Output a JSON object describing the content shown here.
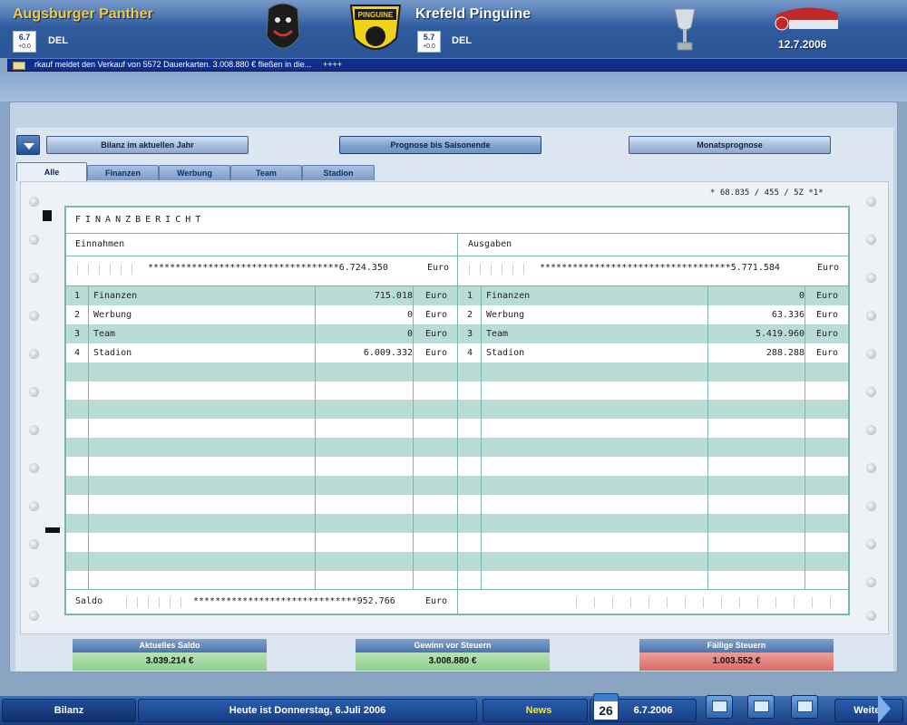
{
  "header": {
    "home_team": "Augsburger Panther",
    "home_rating": "6.7",
    "home_rating_delta": "+0.0",
    "home_league": "DEL",
    "away_team": "Krefeld Pinguine",
    "away_rating": "5.7",
    "away_rating_delta": "+0.0",
    "away_league": "DEL",
    "date": "12.7.2006"
  },
  "ticker": {
    "text": "rkauf meldet den Verkauf von 5572 Dauerkarten. 3.008.880 € fließen in die...",
    "suffix": "++++"
  },
  "toolbar": {
    "btn_current_year": "Bilanz im aktuellen Jahr",
    "btn_forecast_season": "Prognose bis Saisonende",
    "btn_monthly_forecast": "Monatsprognose"
  },
  "tabs": [
    "Alle",
    "Finanzen",
    "Werbung",
    "Team",
    "Stadion"
  ],
  "report": {
    "serial": "* 68.835 / 455 / 5Z  *1*",
    "title": "FINANZBERICHT",
    "income": {
      "label": "Einnahmen",
      "total": "***********************************6.724.350",
      "currency": "Euro",
      "rows": [
        {
          "n": "1",
          "name": "Finanzen",
          "value": "715.018",
          "cur": "Euro"
        },
        {
          "n": "2",
          "name": "Werbung",
          "value": "0",
          "cur": "Euro"
        },
        {
          "n": "3",
          "name": "Team",
          "value": "0",
          "cur": "Euro"
        },
        {
          "n": "4",
          "name": "Stadion",
          "value": "6.009.332",
          "cur": "Euro"
        }
      ]
    },
    "expenses": {
      "label": "Ausgaben",
      "total": "***********************************5.771.584",
      "currency": "Euro",
      "rows": [
        {
          "n": "1",
          "name": "Finanzen",
          "value": "0",
          "cur": "Euro"
        },
        {
          "n": "2",
          "name": "Werbung",
          "value": "63.336",
          "cur": "Euro"
        },
        {
          "n": "3",
          "name": "Team",
          "value": "5.419.960",
          "cur": "Euro"
        },
        {
          "n": "4",
          "name": "Stadion",
          "value": "288.288",
          "cur": "Euro"
        }
      ]
    },
    "saldo_label": "Saldo",
    "saldo_value": "******************************952.766",
    "saldo_currency": "Euro"
  },
  "summary": {
    "current_balance_label": "Aktuelles Saldo",
    "current_balance_value": "3.039.214 €",
    "profit_before_tax_label": "Gewinn vor Steuern",
    "profit_before_tax_value": "3.008.880 €",
    "taxes_due_label": "Fällige Steuern",
    "taxes_due_value": "1.003.552 €"
  },
  "bottombar": {
    "section": "Bilanz",
    "today": "Heute ist Donnerstag, 6.Juli 2006",
    "news": "News",
    "calendar_day": "26",
    "date": "6.7.2006",
    "next": "Weiter"
  }
}
